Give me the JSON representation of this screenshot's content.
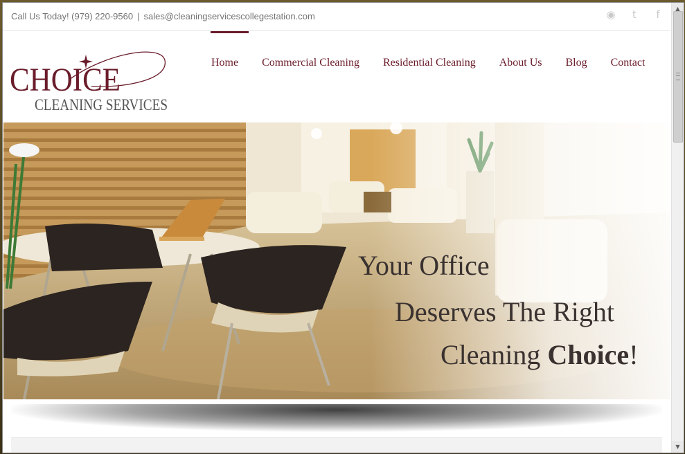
{
  "topbar": {
    "phone_text": "Call Us Today! (979) 220-9560",
    "separator": "|",
    "email": "sales@cleaningservicescollegestation.com",
    "socials": [
      {
        "name": "rss-icon",
        "glyph": "◉"
      },
      {
        "name": "twitter-icon",
        "glyph": "t"
      },
      {
        "name": "facebook-icon",
        "glyph": "f"
      }
    ]
  },
  "logo": {
    "line1": "CHOICE",
    "line2": "CLEANING SERVICES"
  },
  "nav": {
    "items": [
      {
        "label": "Home",
        "active": true
      },
      {
        "label": "Commercial Cleaning",
        "active": false
      },
      {
        "label": "Residential Cleaning",
        "active": false
      },
      {
        "label": "About Us",
        "active": false
      },
      {
        "label": "Blog",
        "active": false
      },
      {
        "label": "Contact",
        "active": false
      }
    ]
  },
  "hero": {
    "line1": "Your Office",
    "line2": "Deserves The Right",
    "line3_prefix": "Cleaning ",
    "line3_bold": "Choice",
    "line3_suffix": "!"
  },
  "colors": {
    "brand": "#6a1c2a",
    "hero_text": "#3a3230",
    "muted": "#747474"
  }
}
